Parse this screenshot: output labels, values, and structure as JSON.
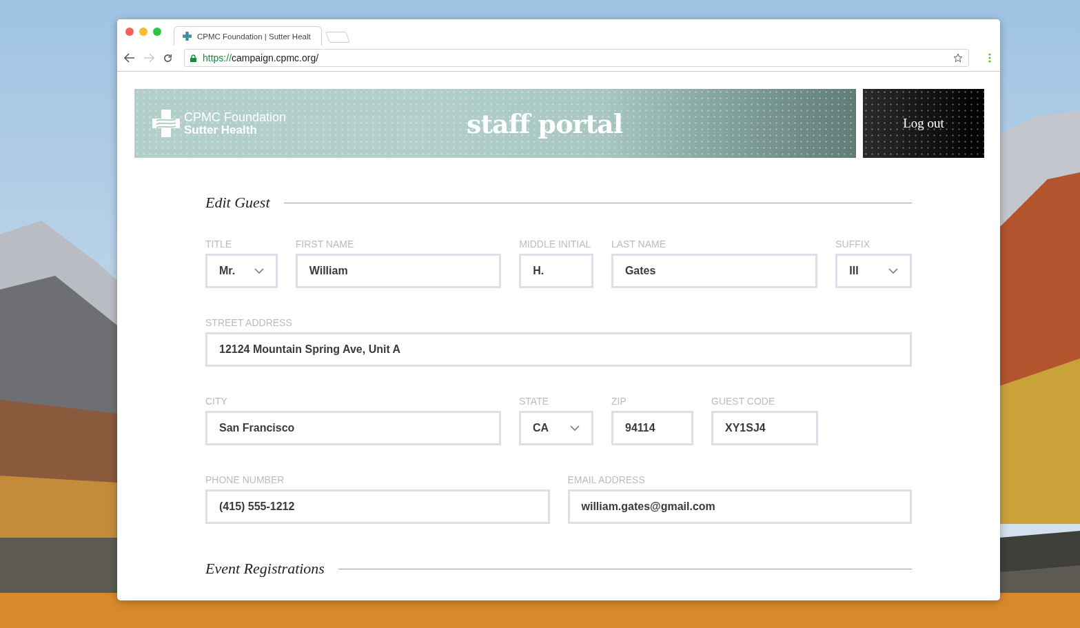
{
  "browser": {
    "tab_title": "CPMC Foundation | Sutter Healt",
    "url": {
      "scheme": "https://",
      "host": "campaign.cpmc.org/"
    }
  },
  "header": {
    "logo_line_1": "CPMC Foundation",
    "logo_line_2": "Sutter Health",
    "title": "staff portal",
    "logout": "Log out"
  },
  "edit_guest": {
    "heading": "Edit Guest",
    "field_groups": [
      [
        {
          "label": "TITLE",
          "value": "Mr.",
          "kind": "select"
        },
        {
          "label": "FIRST NAME",
          "value": "William",
          "kind": "text"
        },
        {
          "label": "MIDDLE INITIAL",
          "value": "H.",
          "kind": "text"
        },
        {
          "label": "LAST NAME",
          "value": "Gates",
          "kind": "text"
        },
        {
          "label": "SUFFIX",
          "value": "III",
          "kind": "select"
        }
      ],
      [
        {
          "label": "STREET ADDRESS",
          "value": "12124 Mountain Spring Ave, Unit A",
          "kind": "text"
        }
      ],
      [
        {
          "label": "CITY",
          "value": "San Francisco",
          "kind": "text"
        },
        {
          "label": "STATE",
          "value": "CA",
          "kind": "select"
        },
        {
          "label": "ZIP",
          "value": "94114",
          "kind": "text"
        },
        {
          "label": "GUEST CODE",
          "value": "XY1SJ4",
          "kind": "text"
        }
      ],
      [
        {
          "label": "PHONE NUMBER",
          "value": "(415) 555-1212",
          "kind": "text"
        },
        {
          "label": "EMAIL ADDRESS",
          "value": "william.gates@gmail.com",
          "kind": "text"
        }
      ]
    ]
  },
  "event_registrations": {
    "heading": "Event Registrations"
  }
}
